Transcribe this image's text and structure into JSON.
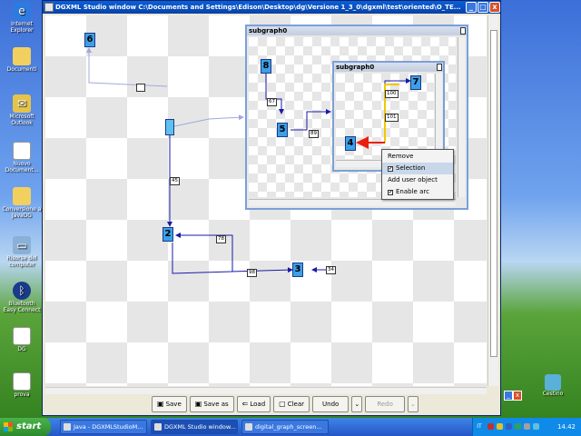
{
  "window": {
    "title": "DGXML Studio window C:\\Documents and Settings\\Edison\\Desktop\\dg\\Versione 1_3_0\\dgxml\\test\\oriented\\O_TE...",
    "controls": [
      "_",
      "□",
      "x"
    ]
  },
  "desktop_icons": [
    {
      "label": "Internet Explorer",
      "icon": "globe-icon"
    },
    {
      "label": "Documenti",
      "icon": "folder-icon"
    },
    {
      "label": "Microsoft Outlook",
      "icon": "outlook-icon"
    },
    {
      "label": "Nuovo Document...",
      "icon": "document-icon"
    },
    {
      "label": "Conversione a JavaDG",
      "icon": "folder-icon"
    },
    {
      "label": "Risorse del computer",
      "icon": "computer-icon"
    },
    {
      "label": "Bluetooth Easy Connect",
      "icon": "bluetooth-icon"
    },
    {
      "label": "DG",
      "icon": "document-icon"
    },
    {
      "label": "prova",
      "icon": "document-icon"
    }
  ],
  "recycle_bin": {
    "label": "Cestino",
    "icon": "recycle-bin-icon"
  },
  "graph": {
    "nodes": [
      {
        "id": "6",
        "label": "6"
      },
      {
        "id": "2",
        "label": "2"
      },
      {
        "id": "3",
        "label": "3"
      },
      {
        "id": "hub",
        "label": ""
      }
    ],
    "edge_labels": [
      {
        "edge": "hub-6",
        "label": ""
      },
      {
        "edge": "hub-2",
        "label": "45"
      },
      {
        "edge": "3-2",
        "label": "78"
      },
      {
        "edge": "2-3",
        "label": "98"
      },
      {
        "edge": "3-self",
        "label": "34"
      }
    ]
  },
  "subgraph0": {
    "title": "subgraph0",
    "nodes": [
      {
        "id": "8",
        "label": "8"
      },
      {
        "id": "5",
        "label": "5"
      }
    ],
    "edge_labels": [
      {
        "edge": "8-5",
        "label": "67"
      },
      {
        "edge": "5-out",
        "label": "89"
      }
    ]
  },
  "subgraph0_inner": {
    "title": "subgraph0",
    "nodes": [
      {
        "id": "7",
        "label": "7"
      },
      {
        "id": "4",
        "label": "4"
      }
    ],
    "edge_labels": [
      {
        "edge": "in-7",
        "label": "100"
      },
      {
        "edge": "7-4",
        "label": "101"
      }
    ]
  },
  "context_menu": {
    "items": [
      {
        "label": "Remove",
        "checkbox": false,
        "checked": false,
        "highlighted": false
      },
      {
        "label": "Selection",
        "checkbox": true,
        "checked": true,
        "highlighted": true
      },
      {
        "label": "Add user object",
        "checkbox": false,
        "checked": false,
        "highlighted": false
      },
      {
        "label": "Enable arc",
        "checkbox": true,
        "checked": true,
        "highlighted": false
      }
    ]
  },
  "toolbar": {
    "save": "Save",
    "save_as": "Save as",
    "load": "Load",
    "clear": "Clear",
    "undo": "Undo",
    "redo": "Redo"
  },
  "taskbar": {
    "start": "start",
    "tasks": [
      {
        "label": "Java - DGXMLStudioM...",
        "active": false
      },
      {
        "label": "DGXML Studio window...",
        "active": true
      },
      {
        "label": "digital_graph_screen...",
        "active": false
      }
    ],
    "language": "IT",
    "clock": "14.42"
  },
  "colors": {
    "node_fill": "#3ca0e8",
    "edge_blue": "#1a1aa8",
    "highlight_red": "#e82010",
    "highlight_yellow": "#f0c800"
  }
}
